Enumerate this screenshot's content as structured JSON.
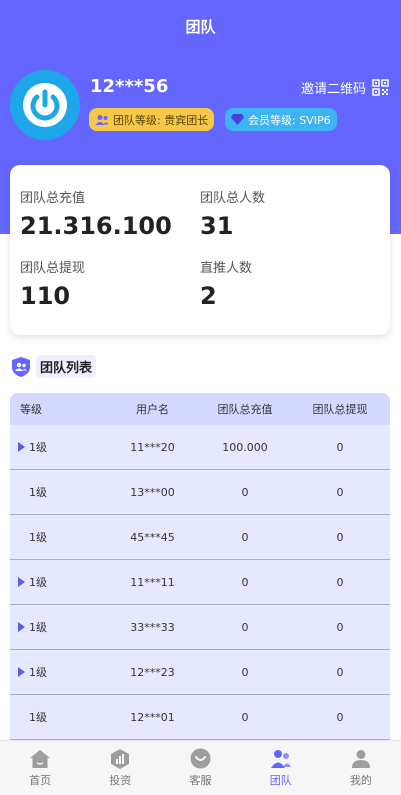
{
  "header": {
    "title": "团队"
  },
  "profile": {
    "username": "12***56",
    "invite_label": "邀请二维码",
    "team_level": "团队等级: 贵宾团长",
    "member_level": "会员等级: SVIP6"
  },
  "stats": {
    "total_recharge_label": "团队总充值",
    "total_recharge_value": "21.316.100",
    "total_members_label": "团队总人数",
    "total_members_value": "31",
    "total_withdraw_label": "团队总提现",
    "total_withdraw_value": "110",
    "direct_label": "直推人数",
    "direct_value": "2"
  },
  "team_list": {
    "title": "团队列表",
    "headers": [
      "等级",
      "用户名",
      "团队总充值",
      "团队总提现"
    ],
    "rows": [
      {
        "level": "1级",
        "user": "11***20",
        "recharge": "100.000",
        "withdraw": "0",
        "expandable": true
      },
      {
        "level": "1级",
        "user": "13***00",
        "recharge": "0",
        "withdraw": "0",
        "expandable": false
      },
      {
        "level": "1级",
        "user": "45***45",
        "recharge": "0",
        "withdraw": "0",
        "expandable": false
      },
      {
        "level": "1级",
        "user": "11***11",
        "recharge": "0",
        "withdraw": "0",
        "expandable": true
      },
      {
        "level": "1级",
        "user": "33***33",
        "recharge": "0",
        "withdraw": "0",
        "expandable": true
      },
      {
        "level": "1级",
        "user": "12***23",
        "recharge": "0",
        "withdraw": "0",
        "expandable": true
      },
      {
        "level": "1级",
        "user": "12***01",
        "recharge": "0",
        "withdraw": "0",
        "expandable": false
      }
    ]
  },
  "tabbar": {
    "items": [
      {
        "label": "首页",
        "icon": "home-icon"
      },
      {
        "label": "投资",
        "icon": "invest-icon"
      },
      {
        "label": "客服",
        "icon": "support-icon"
      },
      {
        "label": "团队",
        "icon": "team-icon",
        "active": true
      },
      {
        "label": "我的",
        "icon": "user-icon"
      }
    ]
  },
  "colors": {
    "accent": "#6466ff",
    "table_bg": "#e6e8ff",
    "team_badge": "#f5c84a",
    "vip_badge": "#3eb2f3"
  }
}
